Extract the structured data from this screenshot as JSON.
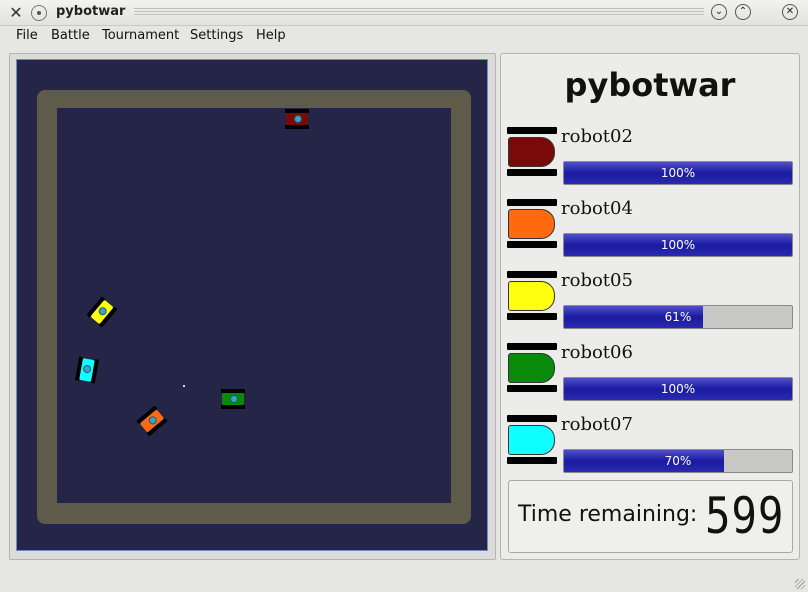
{
  "window": {
    "title": "pybotwar"
  },
  "menu": [
    "File",
    "Battle",
    "Tournament",
    "Settings",
    "Help"
  ],
  "panel": {
    "title": "pybotwar",
    "robots": [
      {
        "name": "robot02",
        "color": "#7a0a0a",
        "health": 100,
        "health_label": "100%"
      },
      {
        "name": "robot04",
        "color": "#ff6a10",
        "health": 100,
        "health_label": "100%"
      },
      {
        "name": "robot05",
        "color": "#ffff10",
        "health": 61,
        "health_label": "61%"
      },
      {
        "name": "robot06",
        "color": "#0a8a0a",
        "health": 100,
        "health_label": "100%"
      },
      {
        "name": "robot07",
        "color": "#10ffff",
        "health": 70,
        "health_label": "70%"
      }
    ],
    "timer_label": "Time remaining:",
    "timer_value": "599"
  },
  "arena": {
    "robots": [
      {
        "id": "robot02",
        "color": "#7a0a0a",
        "heading_deg": 0
      },
      {
        "id": "robot04",
        "color": "#ff6a10",
        "heading_deg": -40
      },
      {
        "id": "robot05",
        "color": "#ffff10",
        "heading_deg": -50
      },
      {
        "id": "robot06",
        "color": "#0a8a0a",
        "heading_deg": 0
      },
      {
        "id": "robot07",
        "color": "#10ffff",
        "heading_deg": -80
      }
    ]
  }
}
